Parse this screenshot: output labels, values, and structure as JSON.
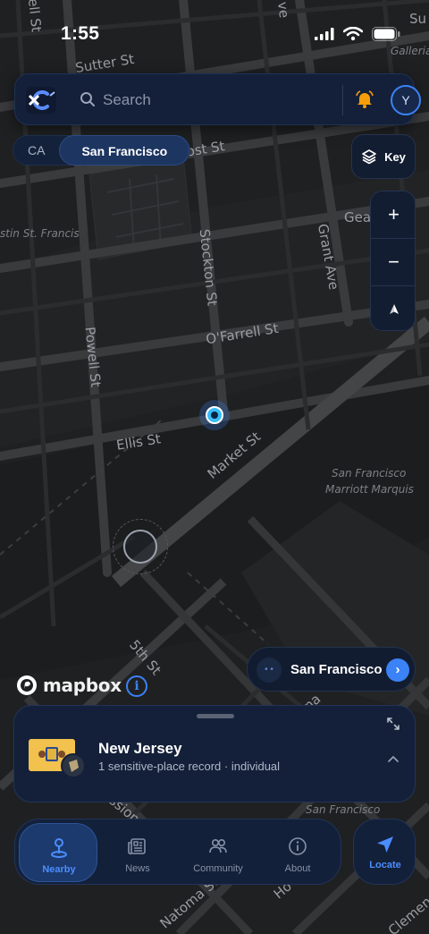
{
  "status": {
    "time": "1:55"
  },
  "map": {
    "labels": {
      "sutter": "Sutter St",
      "post": "Post St",
      "stockton": "Stockton St",
      "grant": "Grant Ave",
      "ofarrell": "O'Farrell St",
      "powell": "Powell St",
      "ellis": "Ellis St",
      "market": "Market St",
      "fifth": "5th St",
      "stfrancis": "stin St. Francis",
      "marriott1": "San Francisco",
      "marriott2": "Marriott Marquis",
      "sf_bottom": "San Francisco",
      "galleria": "Galleria",
      "ell": "ell St",
      "geary": "Gea",
      "su": "Su",
      "ve": "ve",
      "natoma": "Natoma St",
      "clemen": "Clemen",
      "mission": "ssion",
      "ho": "Ho",
      "na": "na"
    },
    "attribution": "mapbox",
    "info_icon": "info-icon"
  },
  "search": {
    "placeholder": "Search",
    "avatar_initial": "Y"
  },
  "region_chips": [
    {
      "label": "CA",
      "active": false
    },
    {
      "label": "San Francisco",
      "active": true
    }
  ],
  "controls": {
    "key_label": "Key",
    "zoom_in": "+",
    "zoom_out": "−"
  },
  "city_pill": {
    "name": "San Francisco"
  },
  "sheet": {
    "title": "New Jersey",
    "subtitle": "1 sensitive-place record · individual"
  },
  "nav": {
    "tabs": [
      {
        "label": "Nearby",
        "icon": "pin-icon",
        "active": true
      },
      {
        "label": "News",
        "icon": "newspaper-icon",
        "active": false
      },
      {
        "label": "Community",
        "icon": "people-icon",
        "active": false
      },
      {
        "label": "About",
        "icon": "info-icon",
        "active": false
      }
    ],
    "locate_label": "Locate"
  },
  "colors": {
    "accent": "#3b82f6",
    "background": "#1f2021",
    "panel": "#142039",
    "bell": "#f59e0b"
  }
}
